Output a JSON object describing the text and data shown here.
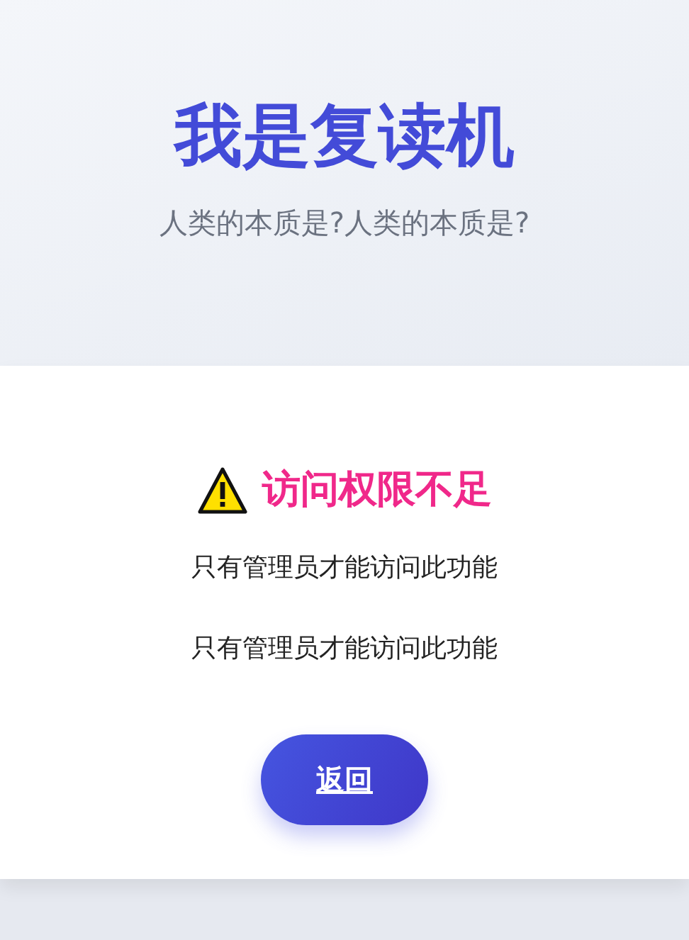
{
  "header": {
    "title": "我是复读机",
    "subtitle": "人类的本质是?人类的本质是?"
  },
  "notice": {
    "heading": "访问权限不足",
    "messages": [
      "只有管理员才能访问此功能",
      "只有管理员才能访问此功能"
    ],
    "button": "返回"
  }
}
